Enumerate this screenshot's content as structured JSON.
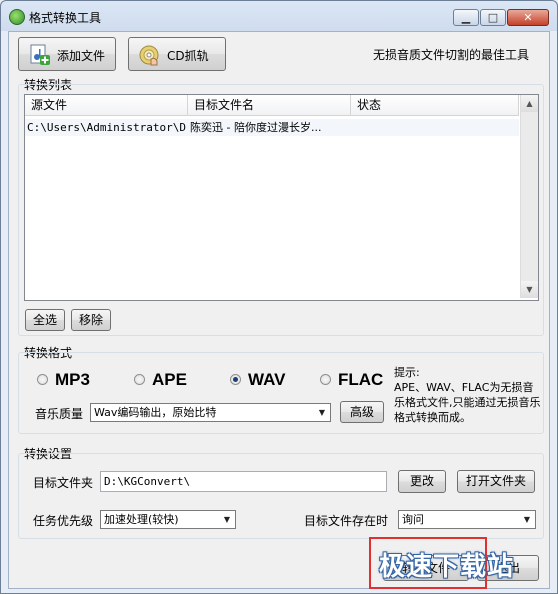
{
  "window": {
    "title": "格式转换工具"
  },
  "toolbar": {
    "add_file": "添加文件",
    "cd_rip": "CD抓轨",
    "tagline": "无损音质文件切割的最佳工具"
  },
  "list_section": {
    "title": "转换列表",
    "columns": [
      "源文件",
      "目标文件名",
      "状态"
    ],
    "rows": [
      {
        "source": "C:\\Users\\Administrator\\D...",
        "target": "陈奕迅 - 陪你度过漫长岁...",
        "status": ""
      }
    ],
    "select_all": "全选",
    "remove": "移除"
  },
  "format_section": {
    "title": "转换格式",
    "formats": [
      "MP3",
      "APE",
      "WAV",
      "FLAC"
    ],
    "selected": "WAV",
    "quality_label": "音乐质量",
    "quality_value": "Wav编码输出，原始比特",
    "advanced": "高级",
    "hint_title": "提示:",
    "hint_body": "APE、WAV、FLAC为无损音乐格式文件,只能通过无损音乐格式转换而成。"
  },
  "settings_section": {
    "title": "转换设置",
    "target_folder_label": "目标文件夹",
    "target_folder_value": "D:\\KGConvert\\",
    "change": "更改",
    "open_folder": "打开文件夹",
    "priority_label": "任务优先级",
    "priority_value": "加速处理(较快)",
    "exists_label": "目标文件存在时",
    "exists_value": "询问"
  },
  "footer": {
    "convert": "转换文件",
    "exit": "退出"
  },
  "watermark": "极速下载站"
}
